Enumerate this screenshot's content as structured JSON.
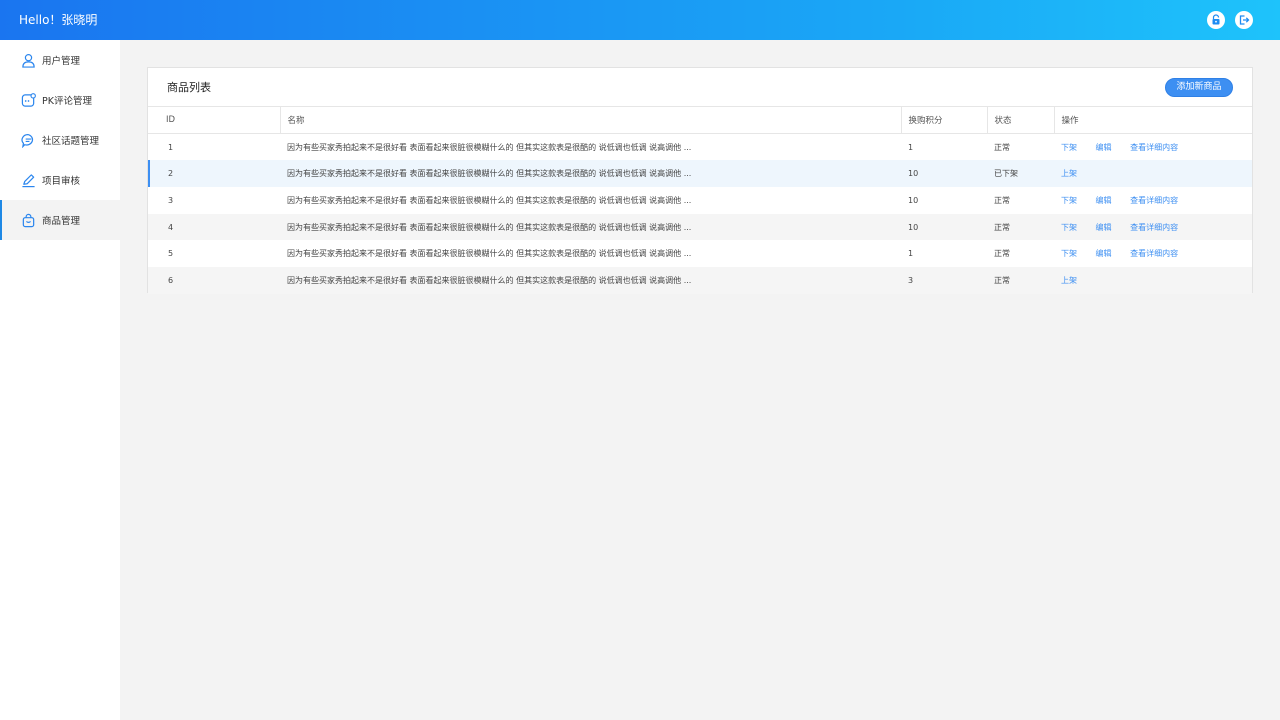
{
  "header": {
    "greeting": "Hello！张晓明",
    "icons": [
      "unlock-icon",
      "logout-icon"
    ]
  },
  "sidebar": {
    "items": [
      {
        "label": "用户管理",
        "icon": "user-icon"
      },
      {
        "label": "PK评论管理",
        "icon": "pk-comment-icon"
      },
      {
        "label": "社区话题管理",
        "icon": "topic-chat-icon"
      },
      {
        "label": "项目审核",
        "icon": "edit-pen-icon"
      },
      {
        "label": "商品管理",
        "icon": "shopping-bag-icon",
        "active": true
      }
    ]
  },
  "panel": {
    "title": "商品列表",
    "add_button": "添加新商品"
  },
  "table": {
    "columns": [
      "ID",
      "名称",
      "换购积分",
      "状态",
      "操作"
    ],
    "rows": [
      {
        "id": "1",
        "name": "因为有些买家秀拍起来不是很好看 表面看起来很脏很模糊什么的 但其实这款表是很酷的 说低调也低调 说高调他 ...",
        "points": "1",
        "status": "正常",
        "actions": [
          "下架",
          "编辑",
          "查看详细内容"
        ]
      },
      {
        "id": "2",
        "name": "因为有些买家秀拍起来不是很好看 表面看起来很脏很模糊什么的 但其实这款表是很酷的 说低调也低调 说高调他 ...",
        "points": "10",
        "status": "已下架",
        "actions": [
          "上架"
        ]
      },
      {
        "id": "3",
        "name": "因为有些买家秀拍起来不是很好看 表面看起来很脏很模糊什么的 但其实这款表是很酷的 说低调也低调 说高调他 ...",
        "points": "10",
        "status": "正常",
        "actions": [
          "下架",
          "编辑",
          "查看详细内容"
        ]
      },
      {
        "id": "4",
        "name": "因为有些买家秀拍起来不是很好看 表面看起来很脏很模糊什么的 但其实这款表是很酷的 说低调也低调 说高调他 ...",
        "points": "10",
        "status": "正常",
        "actions": [
          "下架",
          "编辑",
          "查看详细内容"
        ]
      },
      {
        "id": "5",
        "name": "因为有些买家秀拍起来不是很好看 表面看起来很脏很模糊什么的 但其实这款表是很酷的 说低调也低调 说高调他 ...",
        "points": "1",
        "status": "正常",
        "actions": [
          "下架",
          "编辑",
          "查看详细内容"
        ]
      },
      {
        "id": "6",
        "name": "因为有些买家秀拍起来不是很好看 表面看起来很脏很模糊什么的 但其实这款表是很酷的 说低调也低调 说高调他 ...",
        "points": "3",
        "status": "正常",
        "actions": [
          "上架"
        ]
      }
    ]
  },
  "colors": {
    "accent": "#3d8ff2",
    "header_start": "#1a75f0",
    "header_end": "#1ec3fb",
    "background": "#f3f3f3"
  }
}
